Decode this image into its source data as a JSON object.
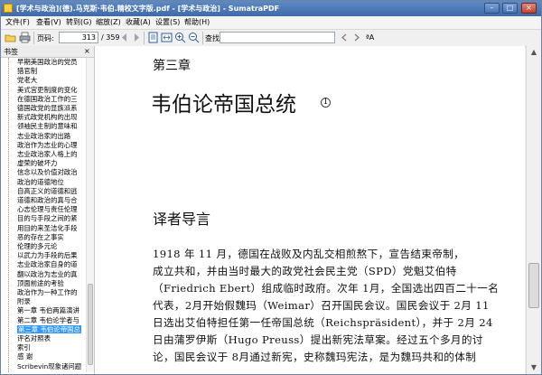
{
  "window": {
    "title": "[学术与政治](德).马克斯·韦伯.精校文字版.pdf - [学术与政治] - SumatraPDF",
    "min_glyph": "–",
    "max_glyph": "□",
    "close_glyph": "×"
  },
  "menu": [
    "文件(F)",
    "查看(V)",
    "转到(G)",
    "缩放(Z)",
    "收藏(A)",
    "设置(S)",
    "帮助(H)"
  ],
  "toolbar": {
    "page_label": "页码:",
    "page_value": "313",
    "page_total": "/ 359",
    "find_label": "查找:",
    "find_value": "",
    "match_case": "ªA"
  },
  "sidebar": {
    "title": "书签",
    "close_glyph": "×",
    "items": [
      "早期美国政治的党员",
      "猎官制",
      "党老大",
      "美式宫吏制度的变化",
      "在德国政治工作的三",
      "德国政党的显族派系",
      "新式政党机构的出现",
      "领袖民主制的意味和",
      "志业政治家的出路",
      "政治作为志业的心理",
      "志业政治家人格上的",
      "虚荣的破坏力",
      "信念以及价值对政治",
      "政治的道德地位",
      "自高正义的道德和逃",
      "道德和政治的真与合",
      "心志伦理与责任伦理",
      "目的与手段之间的紧",
      "用目的来圣洁化手段",
      "恶的存在之事实",
      "伦理的多元论",
      "以武力为手段的后果",
      "志业政治家自身的道",
      "翻以政治为志业的真",
      "顶面前途的考验",
      "政治作为一种工作的",
      "附录",
      "第一章 韦伯两篇演讲",
      "第二章 韦伯论学者与",
      "第三章 韦伯论帝国总",
      "评名对照表",
      "索引",
      "感 谢",
      "Scribevin现象诸问题"
    ],
    "selected_index": 29
  },
  "document": {
    "chapter": "第三章",
    "title": "韦伯论帝国总统",
    "footnote": "1",
    "section": "译者导言",
    "paragraph_lines": [
      "1918 年 11 月，德国在战败及内乱交相煎熬下，宣告结束帝制，",
      "成立共和，并由当时最大的政党社会民主党（SPD）党魁艾伯特",
      "（Friedrich Ebert）组成临时政府。次年 1月，全国选出四百二十一名",
      "代表，2月开始假魏玛（Weimar）召开国民会议。国民会议于 2月 11",
      "日选出艾伯特担任第一任帝国总统（Reichspräsident），并于 2月 24",
      "日由蒲罗伊斯（Hugo Preuss）提出新宪法草案。经过五个多月的讨",
      "论，国民会议于 8月通过新宪，史称魏玛宪法，是为魏玛共和的体制"
    ]
  }
}
